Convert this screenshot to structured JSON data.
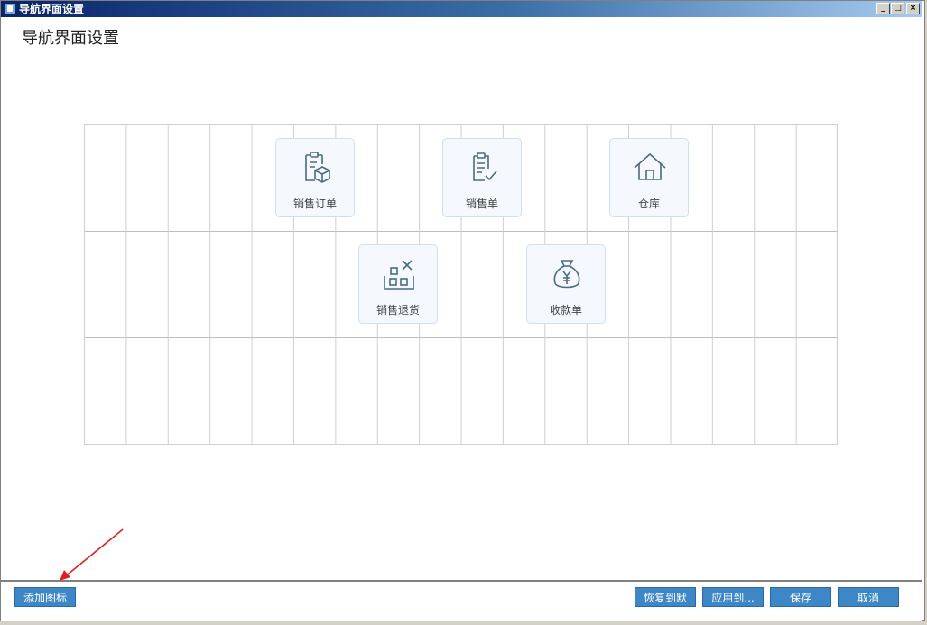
{
  "window": {
    "title": "导航界面设置",
    "controls": {
      "minimize": "_",
      "maximize": "□",
      "close": "×"
    }
  },
  "page": {
    "title": "导航界面设置"
  },
  "tiles": [
    {
      "label": "销售订单",
      "icon": "clipboard-box-icon"
    },
    {
      "label": "销售单",
      "icon": "clipboard-check-icon"
    },
    {
      "label": "仓库",
      "icon": "house-icon"
    },
    {
      "label": "销售退货",
      "icon": "boxes-return-icon"
    },
    {
      "label": "收款单",
      "icon": "money-bag-icon"
    }
  ],
  "footer": {
    "add_icon": "添加图标",
    "restore_default": "恢复到默认",
    "apply_to": "应用到...",
    "save": "保存",
    "cancel": "取消"
  },
  "colors": {
    "accent": "#3d87c6",
    "icon_stroke": "#4a6b85",
    "arrow": "#e02020"
  }
}
